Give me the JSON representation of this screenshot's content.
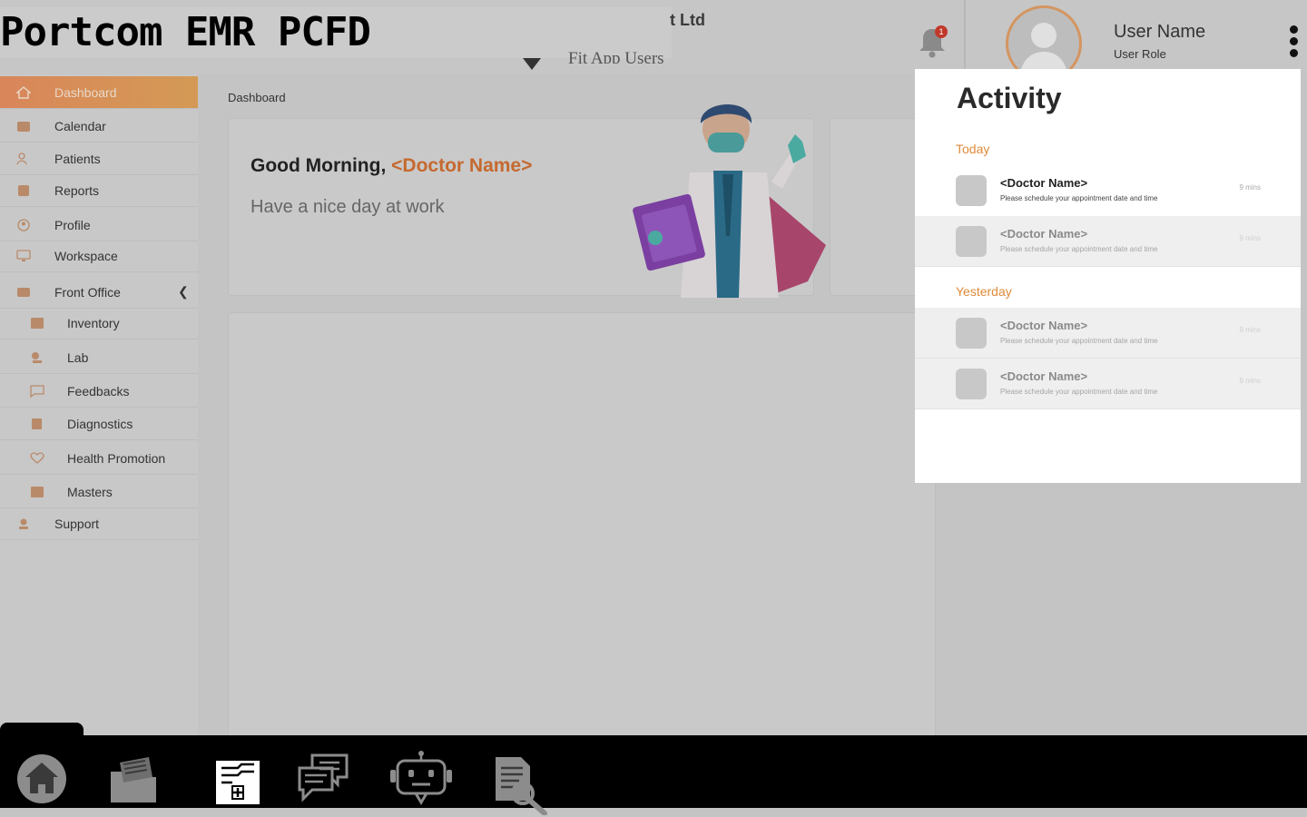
{
  "app": {
    "title": "Portcom EMR PCFD",
    "company_fragment": "t Ltd",
    "sub_company_fragment": "Fit App Users"
  },
  "notifications": {
    "count": "1"
  },
  "user": {
    "name": "User Name",
    "role": "User Role"
  },
  "sidebar": {
    "items": [
      {
        "label": "Dashboard",
        "icon": "home-icon",
        "active": true
      },
      {
        "label": "Calendar",
        "icon": "calendar-icon"
      },
      {
        "label": "Patients",
        "icon": "patients-icon"
      },
      {
        "label": "Reports",
        "icon": "reports-icon"
      },
      {
        "label": "Profile",
        "icon": "profile-icon"
      },
      {
        "label": "Workspace",
        "icon": "workspace-icon"
      },
      {
        "label": "Front Office",
        "icon": "front-office-icon",
        "expanded": true
      }
    ],
    "front_office_items": [
      {
        "label": "Inventory",
        "icon": "inventory-icon"
      },
      {
        "label": "Lab",
        "icon": "lab-icon"
      },
      {
        "label": "Feedbacks",
        "icon": "feedback-icon"
      },
      {
        "label": "Diagnostics",
        "icon": "diagnostics-icon"
      },
      {
        "label": "Health Promotion",
        "icon": "health-promotion-icon"
      },
      {
        "label": "Masters",
        "icon": "masters-icon"
      }
    ],
    "support": {
      "label": "Support",
      "icon": "support-icon"
    }
  },
  "main": {
    "breadcrumb": "Dashboard",
    "greeting_prefix": "Good Morning, ",
    "greeting_name": "<Doctor Name>",
    "greeting_sub": "Have a nice day at work"
  },
  "activity": {
    "title": "Activity",
    "sections": [
      {
        "label": "Today",
        "items": [
          {
            "name": "<Doctor Name>",
            "message": "Please schedule your appointment date and time",
            "time": "9 mins"
          },
          {
            "name": "<Doctor Name>",
            "message": "Please schedule your appointment date and time",
            "time": "9 mins"
          }
        ]
      },
      {
        "label": "Yesterday",
        "items": [
          {
            "name": "<Doctor Name>",
            "message": "Please schedule your appointment date and time",
            "time": "9 mins"
          },
          {
            "name": "<Doctor Name>",
            "message": "Please schedule your appointment date and time",
            "time": "9 mins"
          }
        ]
      }
    ]
  },
  "dock": {
    "icons": [
      "home-icon",
      "folder-icon",
      "medical-records-icon",
      "chat-icon",
      "bot-icon",
      "document-search-icon"
    ]
  },
  "colors": {
    "accent": "#e08a3a",
    "active_menu": "#d9865a",
    "dock_background": "#000000",
    "overlay_background": "#c4c4c4"
  }
}
